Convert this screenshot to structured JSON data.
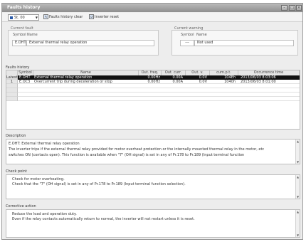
{
  "window": {
    "title": "Faults history"
  },
  "toolbar": {
    "station": "St. 00",
    "clear_label": "Faults history clear",
    "reset_label": "Inverter reset"
  },
  "current_fault": {
    "group_label": "Current fault",
    "symbol_header": "Symbol",
    "name_header": "Name",
    "symbol": "E.OHT",
    "name": "External thermal relay operation"
  },
  "current_warning": {
    "group_label": "Current warning",
    "symbol_header": "Symbol",
    "name_header": "Name",
    "symbol": "---",
    "name": "Not used"
  },
  "faults_history": {
    "label": "Faults history",
    "columns": [
      "Symbol",
      "Name",
      "Out. freq.",
      "Out. curr.",
      "Out. v.",
      "cum.p.t.",
      "Occurrence time"
    ],
    "rows": [
      {
        "index": "Latest",
        "symbol": "E.OHT",
        "name": "External thermal relay operation",
        "freq": "0.00Hz",
        "curr": "0.00A",
        "volt": "0.0V",
        "cumt": "104Eh",
        "time": "2013/06/03 8:03:06"
      },
      {
        "index": "1",
        "symbol": "E.OC3",
        "name": "Overcurrent trip during deceleration or stop",
        "freq": "0.00Hz",
        "curr": "0.00A",
        "volt": "0.0V",
        "cumt": "1040h",
        "time": "2013/06/03 8:01:00"
      },
      {
        "index": "",
        "symbol": "",
        "name": "",
        "freq": "",
        "curr": "",
        "volt": "",
        "cumt": "",
        "time": ""
      },
      {
        "index": "",
        "symbol": "",
        "name": "",
        "freq": "",
        "curr": "",
        "volt": "",
        "cumt": "",
        "time": ""
      },
      {
        "index": "",
        "symbol": "",
        "name": "",
        "freq": "",
        "curr": "",
        "volt": "",
        "cumt": "",
        "time": ""
      },
      {
        "index": "",
        "symbol": "",
        "name": "",
        "freq": "",
        "curr": "",
        "volt": "",
        "cumt": "",
        "time": ""
      }
    ]
  },
  "description": {
    "label": "Description",
    "lines": [
      "E.OHT: External thermal relay operation",
      "The inverter trips if the external thermal relay provided for motor overheat protection or the internally mounted thermal relay in the motor, etc",
      "switches ON (contacts open). This function is available when \"7\" (OH signal) is set in any of Pr.178 to Pr.189 (Input terminal function"
    ]
  },
  "check_point": {
    "label": "Check point",
    "lines": [
      "Check for motor overheating.",
      "Check that the \"7\" (OH signal) is set in any of Pr.178 to Pr.189 (Input terminal function selection)."
    ]
  },
  "corrective_action": {
    "label": "Corrective action",
    "lines": [
      "Reduce the load and operation duty.",
      "Even if the relay contacts automatically return to normal, the inverter will not restart unless it is reset."
    ]
  }
}
